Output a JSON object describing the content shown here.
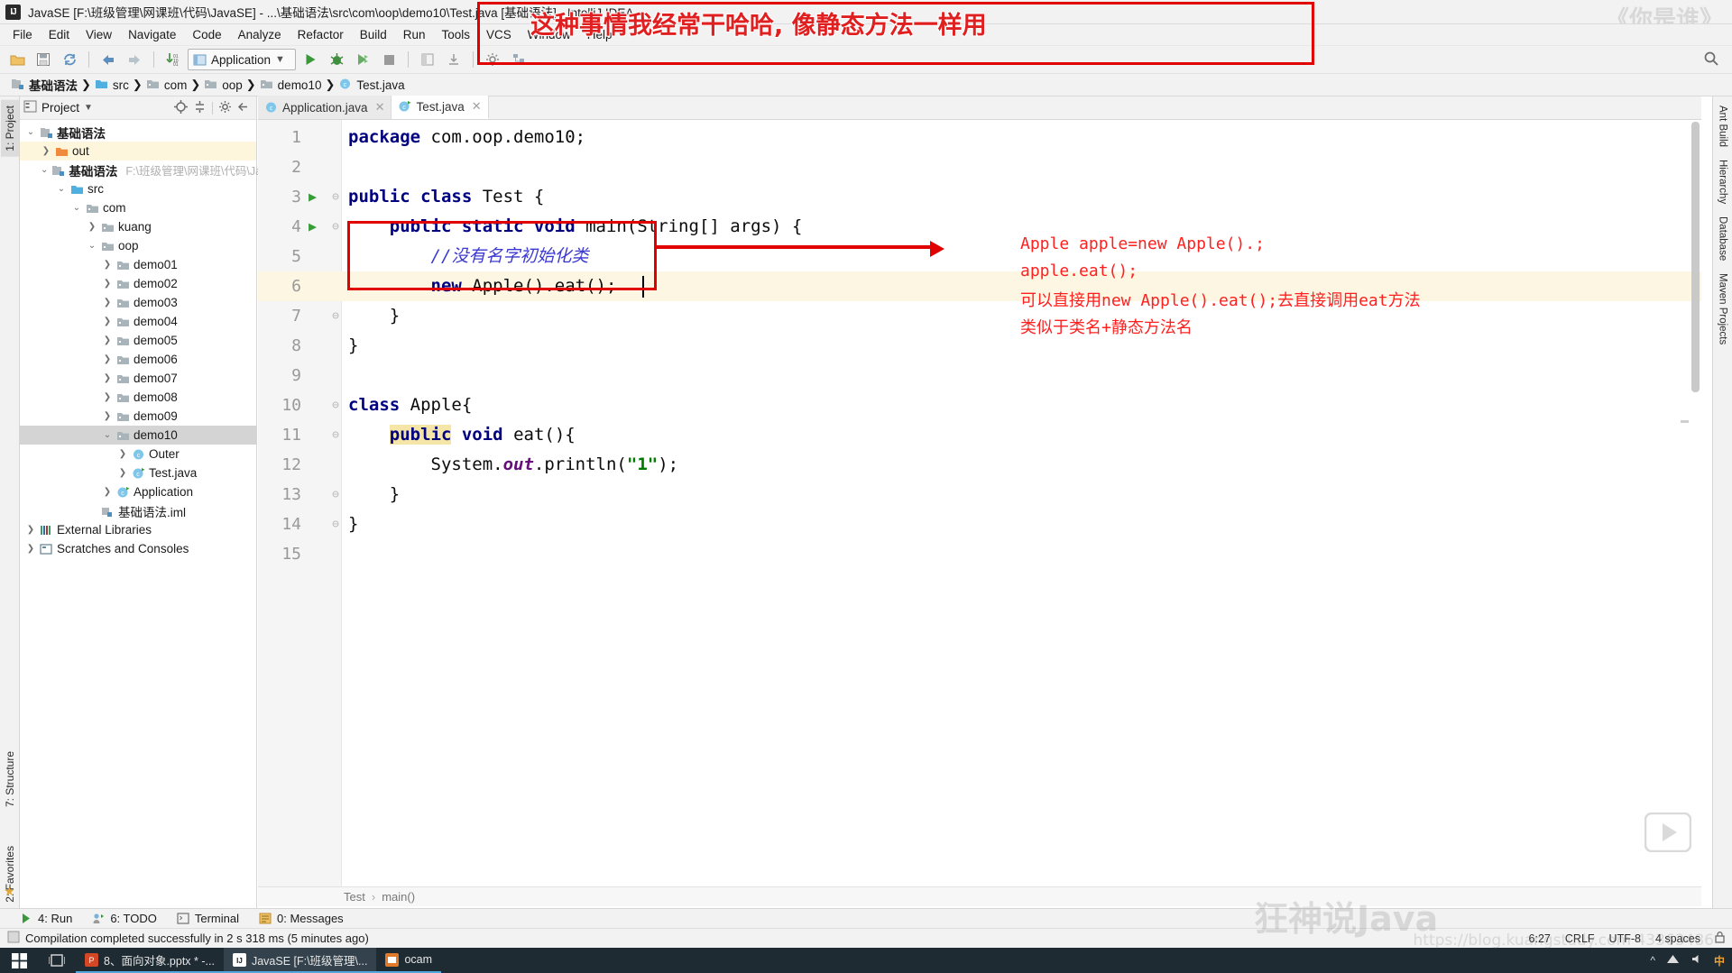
{
  "window": {
    "title": "JavaSE [F:\\班级管理\\网课班\\代码\\JavaSE] - ...\\基础语法\\src\\com\\oop\\demo10\\Test.java [基础语法] - IntelliJ IDEA",
    "logo": "IJ",
    "right_watermark": "《你是谁》"
  },
  "menubar": {
    "items": [
      {
        "label": "File"
      },
      {
        "label": "Edit"
      },
      {
        "label": "View"
      },
      {
        "label": "Navigate"
      },
      {
        "label": "Code"
      },
      {
        "label": "Analyze"
      },
      {
        "label": "Refactor"
      },
      {
        "label": "Build"
      },
      {
        "label": "Run"
      },
      {
        "label": "Tools"
      },
      {
        "label": "VCS"
      },
      {
        "label": "Window"
      },
      {
        "label": "Help"
      }
    ]
  },
  "toolbar": {
    "open_icon": "folder-open-icon",
    "save_icon": "save-icon",
    "sync_icon": "sync-icon",
    "back_icon": "back-arrow-icon",
    "forward_icon": "forward-arrow-icon",
    "update_icon": "update-project-icon",
    "run_config": "Application",
    "run_icon": "run-icon",
    "debug_icon": "debug-icon",
    "coverage_icon": "run-with-coverage-icon",
    "stop_icon": "stop-icon",
    "search_icon": "search-everywhere-icon"
  },
  "breadcrumbs": [
    {
      "label": "基础语法",
      "icon": "module-icon",
      "bold": true
    },
    {
      "label": "src",
      "icon": "source-folder-icon",
      "bold": false
    },
    {
      "label": "com",
      "icon": "package-icon",
      "bold": false
    },
    {
      "label": "oop",
      "icon": "package-icon",
      "bold": false
    },
    {
      "label": "demo10",
      "icon": "package-icon",
      "bold": false
    },
    {
      "label": "Test.java",
      "icon": "java-class-icon",
      "bold": false
    }
  ],
  "left_strip": {
    "project_tab": "1: Project",
    "structure_tab": "7: Structure",
    "favorites_tab": "2: Favorites"
  },
  "right_strip": {
    "tabs": [
      "Ant Build",
      "Hierarchy",
      "Database",
      "Maven Projects"
    ]
  },
  "project_panel": {
    "header": "Project",
    "expand_icon": "target-icon",
    "collapse_icon": "collapse-all-icon",
    "settings_icon": "gear-icon",
    "hide_icon": "hide-icon",
    "tree": [
      {
        "label": "基础语法",
        "depth": 0,
        "arrow": "v",
        "icon": "module-icon",
        "bold": true,
        "state": ""
      },
      {
        "label": "out",
        "depth": 1,
        "arrow": ">",
        "icon": "orange-folder-icon",
        "bold": false,
        "state": "hl"
      },
      {
        "label": "基础语法",
        "depth": 1,
        "arrow": "v",
        "icon": "module-icon",
        "bold": true,
        "state": "",
        "path": "F:\\班级管理\\网课班\\代码\\Ja"
      },
      {
        "label": "src",
        "depth": 2,
        "arrow": "v",
        "icon": "source-folder-icon",
        "bold": false,
        "state": ""
      },
      {
        "label": "com",
        "depth": 3,
        "arrow": "v",
        "icon": "package-icon",
        "bold": false,
        "state": ""
      },
      {
        "label": "kuang",
        "depth": 4,
        "arrow": ">",
        "icon": "package-icon",
        "bold": false,
        "state": ""
      },
      {
        "label": "oop",
        "depth": 4,
        "arrow": "v",
        "icon": "package-icon",
        "bold": false,
        "state": ""
      },
      {
        "label": "demo01",
        "depth": 5,
        "arrow": ">",
        "icon": "package-icon",
        "bold": false,
        "state": ""
      },
      {
        "label": "demo02",
        "depth": 5,
        "arrow": ">",
        "icon": "package-icon",
        "bold": false,
        "state": ""
      },
      {
        "label": "demo03",
        "depth": 5,
        "arrow": ">",
        "icon": "package-icon",
        "bold": false,
        "state": ""
      },
      {
        "label": "demo04",
        "depth": 5,
        "arrow": ">",
        "icon": "package-icon",
        "bold": false,
        "state": ""
      },
      {
        "label": "demo05",
        "depth": 5,
        "arrow": ">",
        "icon": "package-icon",
        "bold": false,
        "state": ""
      },
      {
        "label": "demo06",
        "depth": 5,
        "arrow": ">",
        "icon": "package-icon",
        "bold": false,
        "state": ""
      },
      {
        "label": "demo07",
        "depth": 5,
        "arrow": ">",
        "icon": "package-icon",
        "bold": false,
        "state": ""
      },
      {
        "label": "demo08",
        "depth": 5,
        "arrow": ">",
        "icon": "package-icon",
        "bold": false,
        "state": ""
      },
      {
        "label": "demo09",
        "depth": 5,
        "arrow": ">",
        "icon": "package-icon",
        "bold": false,
        "state": ""
      },
      {
        "label": "demo10",
        "depth": 5,
        "arrow": "v",
        "icon": "package-icon",
        "bold": false,
        "state": "sel"
      },
      {
        "label": "Outer",
        "depth": 6,
        "arrow": ">",
        "icon": "java-class-icon",
        "bold": false,
        "state": ""
      },
      {
        "label": "Test.java",
        "depth": 6,
        "arrow": ">",
        "icon": "java-runnable-class-icon",
        "bold": false,
        "state": ""
      },
      {
        "label": "Application",
        "depth": 5,
        "arrow": ">",
        "icon": "java-runnable-class-icon",
        "bold": false,
        "state": ""
      },
      {
        "label": "基础语法.iml",
        "depth": 4,
        "arrow": "",
        "icon": "iml-file-icon",
        "bold": false,
        "state": ""
      },
      {
        "label": "External Libraries",
        "depth": 0,
        "arrow": ">",
        "icon": "libraries-icon",
        "bold": false,
        "state": ""
      },
      {
        "label": "Scratches and Consoles",
        "depth": 0,
        "arrow": ">",
        "icon": "scratches-icon",
        "bold": false,
        "state": ""
      }
    ]
  },
  "editor_tabs": [
    {
      "label": "Application.java",
      "icon": "java-class-icon",
      "active": false
    },
    {
      "label": "Test.java",
      "icon": "java-runnable-class-icon",
      "active": true
    }
  ],
  "code": {
    "lines": [
      {
        "num": "1",
        "tokens": [
          {
            "t": "package",
            "c": "kw"
          },
          {
            "t": " com.oop.demo10;",
            "c": ""
          }
        ],
        "indent": 0,
        "marker": "",
        "fold": ""
      },
      {
        "num": "2",
        "tokens": [],
        "indent": 0,
        "marker": "",
        "fold": ""
      },
      {
        "num": "3",
        "tokens": [
          {
            "t": "public class",
            "c": "kw"
          },
          {
            "t": " Test {",
            "c": ""
          }
        ],
        "indent": 0,
        "marker": "run",
        "fold": "-"
      },
      {
        "num": "4",
        "tokens": [
          {
            "t": "    ",
            "c": ""
          },
          {
            "t": "public static void",
            "c": "kw"
          },
          {
            "t": " main(String[] args) {",
            "c": ""
          }
        ],
        "indent": 0,
        "marker": "run",
        "fold": "-"
      },
      {
        "num": "5",
        "tokens": [
          {
            "t": "        ",
            "c": ""
          },
          {
            "t": "//没有名字初始化类",
            "c": "cmt-blue"
          }
        ],
        "indent": 0,
        "marker": "",
        "fold": ""
      },
      {
        "num": "6",
        "tokens": [
          {
            "t": "        ",
            "c": ""
          },
          {
            "t": "new",
            "c": "kw"
          },
          {
            "t": " Apple().eat();",
            "c": ""
          }
        ],
        "indent": 0,
        "marker": "",
        "fold": "",
        "highlight": true
      },
      {
        "num": "7",
        "tokens": [
          {
            "t": "    }",
            "c": ""
          }
        ],
        "indent": 0,
        "marker": "",
        "fold": "-"
      },
      {
        "num": "8",
        "tokens": [
          {
            "t": "}",
            "c": ""
          }
        ],
        "indent": 0,
        "marker": "",
        "fold": ""
      },
      {
        "num": "9",
        "tokens": [],
        "indent": 0,
        "marker": "",
        "fold": ""
      },
      {
        "num": "10",
        "tokens": [
          {
            "t": "class",
            "c": "kw"
          },
          {
            "t": " Apple{",
            "c": ""
          }
        ],
        "indent": 0,
        "marker": "",
        "fold": "-"
      },
      {
        "num": "11",
        "tokens": [
          {
            "t": "    ",
            "c": ""
          },
          {
            "t": "public",
            "c": "kw-hl"
          },
          {
            "t": " ",
            "c": ""
          },
          {
            "t": "void",
            "c": "kw"
          },
          {
            "t": " eat(){",
            "c": ""
          }
        ],
        "indent": 0,
        "marker": "",
        "fold": "-"
      },
      {
        "num": "12",
        "tokens": [
          {
            "t": "        System.",
            "c": ""
          },
          {
            "t": "out",
            "c": "fieldit"
          },
          {
            "t": ".println(",
            "c": ""
          },
          {
            "t": "\"1\"",
            "c": "str"
          },
          {
            "t": ");",
            "c": ""
          }
        ],
        "indent": 0,
        "marker": "",
        "fold": ""
      },
      {
        "num": "13",
        "tokens": [
          {
            "t": "    }",
            "c": ""
          }
        ],
        "indent": 0,
        "marker": "",
        "fold": "-"
      },
      {
        "num": "14",
        "tokens": [
          {
            "t": "}",
            "c": ""
          }
        ],
        "indent": 0,
        "marker": "",
        "fold": "-"
      },
      {
        "num": "15",
        "tokens": [],
        "indent": 0,
        "marker": "",
        "fold": ""
      }
    ]
  },
  "annotations": {
    "banner_text": "这种事情我经常干哈哈, 像静态方法一样用",
    "red_lines": [
      "Apple apple=new Apple().;",
      "apple.eat();",
      "可以直接用new Apple().eat();去直接调用eat方法",
      "类似于类名+静态方法名"
    ],
    "color": "#ff2020",
    "box_color": "#e00000"
  },
  "editor_breadcrumb": [
    "Test",
    "main()"
  ],
  "toolwindow_bar": [
    {
      "label": "4: Run",
      "icon": "run-icon"
    },
    {
      "label": "6: TODO",
      "icon": "todo-icon"
    },
    {
      "label": "Terminal",
      "icon": "terminal-icon"
    },
    {
      "label": "0: Messages",
      "icon": "messages-icon"
    }
  ],
  "statusbar": {
    "message": "Compilation completed successfully in 2 s 318 ms (5 minutes ago)",
    "icon": "build-icon",
    "caret": "6:27",
    "line_sep": "CRLF",
    "encoding": "UTF-8",
    "indent": "4 spaces",
    "lock_icon": "lock-icon"
  },
  "taskbar": {
    "start_icon": "windows-start-icon",
    "taskview_icon": "task-view-icon",
    "items": [
      {
        "label": "8、面向对象.pptx * -...",
        "icon": "powerpoint-icon",
        "state": "open"
      },
      {
        "label": "JavaSE [F:\\班级管理\\...",
        "icon": "intellij-icon",
        "state": "active"
      },
      {
        "label": "ocam",
        "icon": "ocam-icon",
        "state": "open"
      }
    ],
    "tray": [
      "^",
      "network-icon",
      "volume-icon",
      "ime-icon"
    ]
  },
  "watermarks": {
    "bottom_center": "狂神说Java",
    "bottom_right_url": "https://blog.kuangstudy.com 43363486",
    "play_icon": "play-button-icon"
  }
}
